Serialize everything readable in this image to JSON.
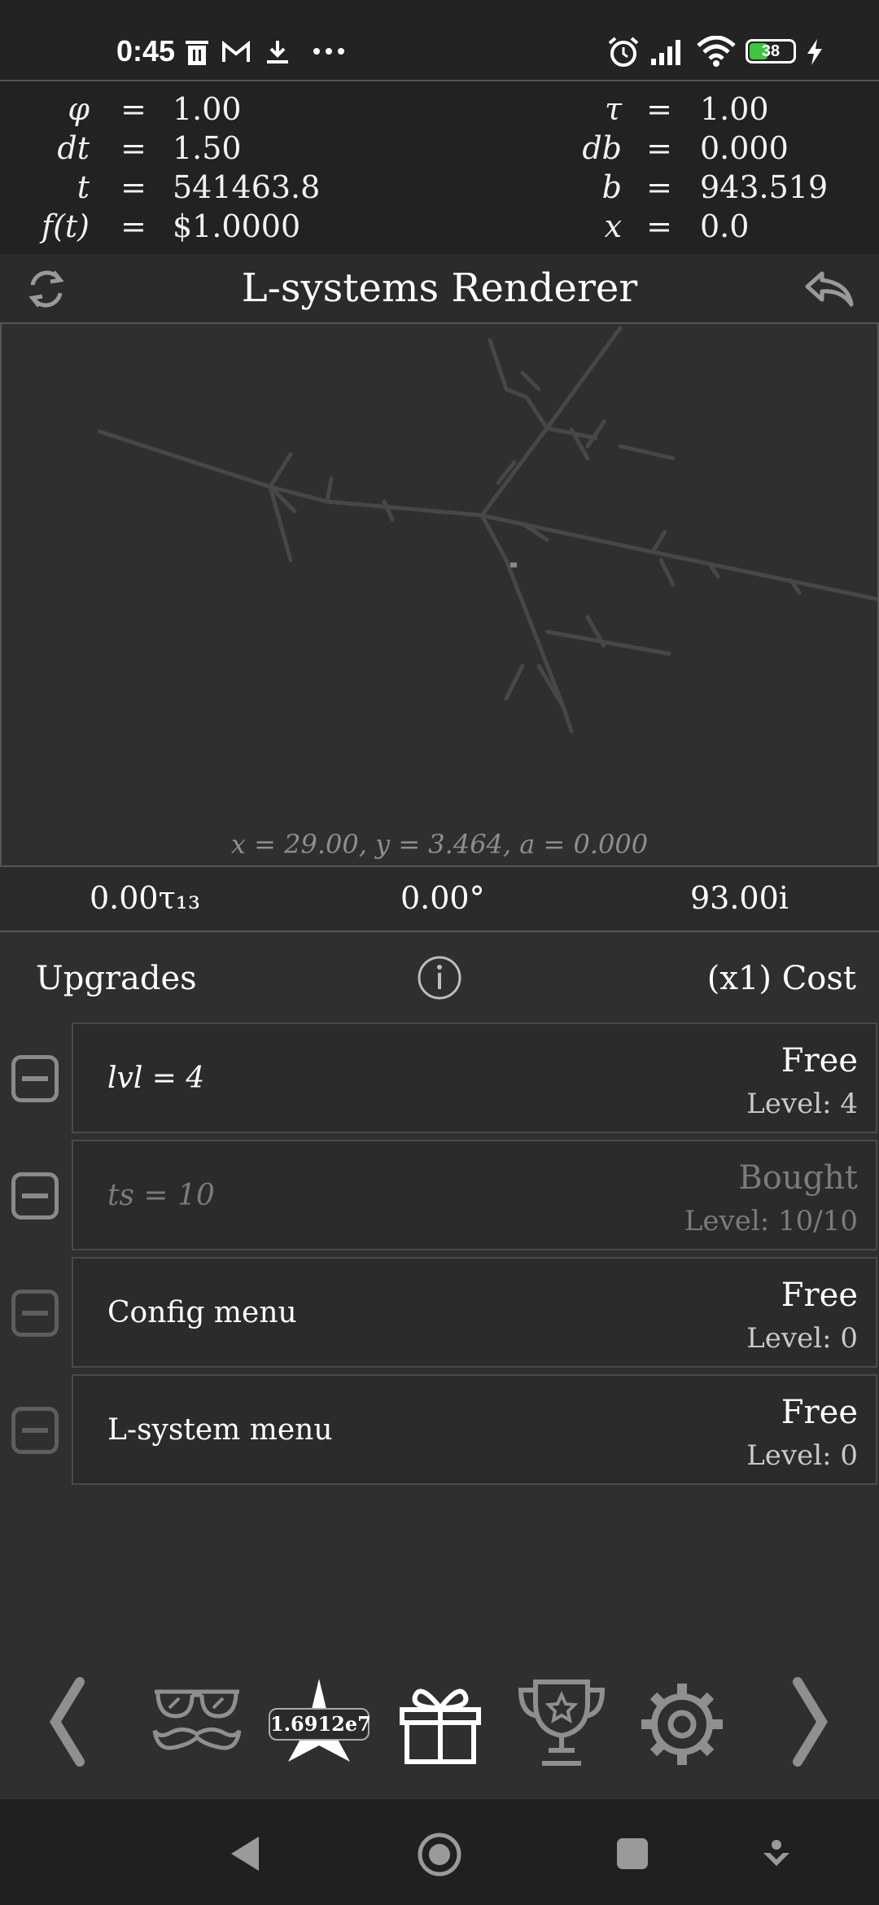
{
  "status_bar": {
    "time": "0:45",
    "battery": "38",
    "icons": [
      "trash-icon",
      "gmail-icon",
      "download-icon",
      "more-dots-icon",
      "alarm-icon",
      "signal-icon",
      "wifi-icon",
      "battery-icon",
      "charging-icon"
    ]
  },
  "variables": {
    "left": [
      {
        "name": "φ",
        "eq": "=",
        "value": "1.00"
      },
      {
        "name": "dt",
        "eq": "=",
        "value": "1.50"
      },
      {
        "name": "t",
        "eq": "=",
        "value": "541463.8"
      },
      {
        "name": "f(t)",
        "eq": "=",
        "value": "$1.0000"
      }
    ],
    "right": [
      {
        "name": "τ",
        "eq": "=",
        "value": "1.00"
      },
      {
        "name": "db",
        "eq": "=",
        "value": "0.000"
      },
      {
        "name": "b",
        "eq": "=",
        "value": "943.519"
      },
      {
        "name": "x",
        "eq": "=",
        "value": "0.0"
      }
    ]
  },
  "header": {
    "title": "L-systems Renderer",
    "left_icon": "refresh-icon",
    "right_icon": "undo-icon"
  },
  "canvas": {
    "coords": "x = 29.00,   y = 3.464,   a = 0.000"
  },
  "stats": {
    "tau": "0.00τ₁₃",
    "angle": "0.00°",
    "imag": "93.00i"
  },
  "upgrades": {
    "title": "Upgrades",
    "multiplier_cost": "(x1) Cost",
    "info_icon": "info-icon",
    "items": [
      {
        "name": "lvl = 4",
        "cost": "Free",
        "level": "Level: 4"
      },
      {
        "name": "ts = 10",
        "cost": "Bought",
        "level": "Level: 10/10"
      },
      {
        "name": "Config menu",
        "cost": "Free",
        "level": "Level: 0"
      },
      {
        "name": "L-system menu",
        "cost": "Free",
        "level": "Level: 0"
      }
    ]
  },
  "bottom_nav": {
    "badge": "1.6912e7",
    "items": [
      "chevron-left-icon",
      "glasses-mustache-icon",
      "star-icon",
      "gift-icon",
      "trophy-icon",
      "gear-icon",
      "chevron-right-icon"
    ]
  },
  "system_nav": [
    "back-icon",
    "home-icon",
    "recents-icon",
    "assistant-icon"
  ],
  "colors": {
    "background": "#2f2f2f",
    "panel": "#222222",
    "battery_green": "#3ec43e",
    "text_dim": "#7b7b7b"
  }
}
